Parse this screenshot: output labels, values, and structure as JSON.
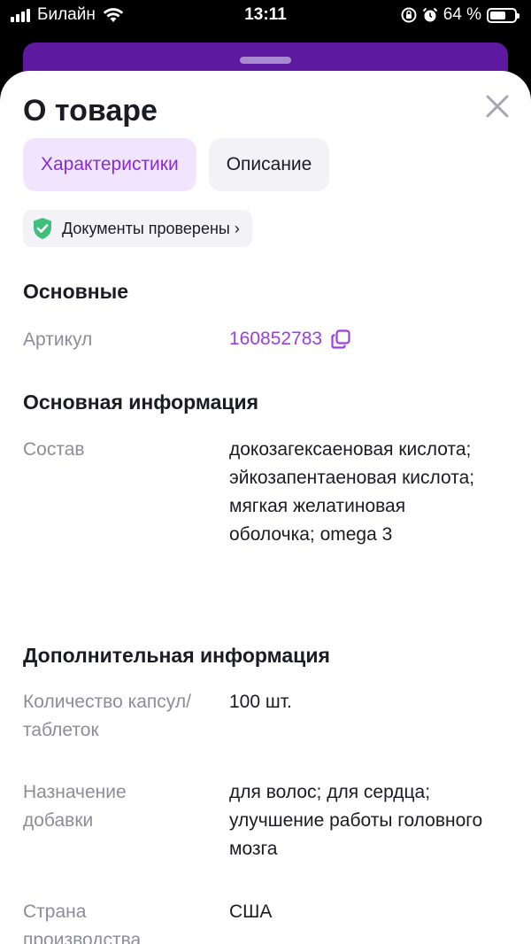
{
  "status_bar": {
    "carrier": "Билайн",
    "time": "13:11",
    "battery": "64 %",
    "battery_level": 0.64,
    "icons": [
      "signal-icon",
      "wifi-icon",
      "orientation-lock-icon",
      "alarm-icon",
      "battery-icon"
    ]
  },
  "sheet": {
    "title": "О товаре",
    "tabs": [
      {
        "label": "Характеристики",
        "active": true
      },
      {
        "label": "Описание",
        "active": false
      }
    ],
    "verified_badge": "Документы проверены ›"
  },
  "sections": [
    {
      "title": "Основные",
      "rows": [
        {
          "label": "Артикул",
          "value": "160852783"
        }
      ]
    },
    {
      "title": "Основная информация",
      "rows": [
        {
          "label": "Состав",
          "value": "докозагексаеновая кислота; эйкозапентаеновая кислота; мягкая желатиновая оболочка; omega 3"
        }
      ]
    },
    {
      "title": "Дополнительная информация",
      "rows": [
        {
          "label": "Количество капсул/таблеток",
          "value": "100 шт."
        },
        {
          "label": "Назначение добавки",
          "value": "для волос; для сердца; улучшение работы головного мозга"
        },
        {
          "label": "Страна производства",
          "value": "США"
        }
      ]
    }
  ],
  "colors": {
    "accent": "#8a2bd9",
    "sku": "#9b3fe0",
    "active_tab_bg": "#f1e5fd",
    "inactive_bg": "#f3f2f7",
    "backdrop": "#5d1aa0",
    "verified_green": "#3ec07a"
  }
}
